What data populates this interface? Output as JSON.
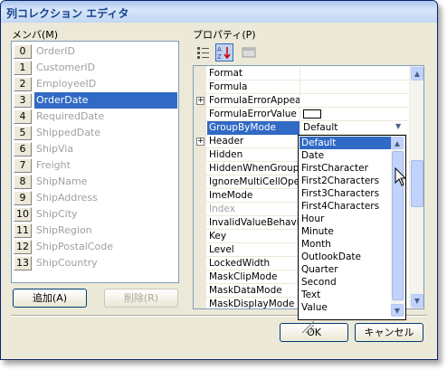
{
  "window": {
    "title": "列コレクション エディタ"
  },
  "members": {
    "label": "メンバ(M)",
    "items": [
      {
        "index": "0",
        "name": "OrderID"
      },
      {
        "index": "1",
        "name": "CustomerID"
      },
      {
        "index": "2",
        "name": "EmployeeID"
      },
      {
        "index": "3",
        "name": "OrderDate"
      },
      {
        "index": "4",
        "name": "RequiredDate"
      },
      {
        "index": "5",
        "name": "ShippedDate"
      },
      {
        "index": "6",
        "name": "ShipVia"
      },
      {
        "index": "7",
        "name": "Freight"
      },
      {
        "index": "8",
        "name": "ShipName"
      },
      {
        "index": "9",
        "name": "ShipAddress"
      },
      {
        "index": "10",
        "name": "ShipCity"
      },
      {
        "index": "11",
        "name": "ShipRegion"
      },
      {
        "index": "12",
        "name": "ShipPostalCode"
      },
      {
        "index": "13",
        "name": "ShipCountry"
      }
    ],
    "selected_index": 3,
    "add_label": "追加(A)",
    "remove_label": "削除(R)"
  },
  "properties": {
    "label": "プロパティ(P)",
    "rows": [
      {
        "name": "Format",
        "value": ""
      },
      {
        "name": "Formula",
        "value": ""
      },
      {
        "name": "FormulaErrorAppear",
        "value": ""
      },
      {
        "name": "FormulaErrorValue",
        "value": ""
      },
      {
        "name": "GroupByMode",
        "value": "Default"
      },
      {
        "name": "Header",
        "value": ""
      },
      {
        "name": "Hidden",
        "value": ""
      },
      {
        "name": "HiddenWhenGroupB",
        "value": ""
      },
      {
        "name": "IgnoreMultiCellOper",
        "value": ""
      },
      {
        "name": "ImeMode",
        "value": ""
      },
      {
        "name": "Index",
        "value": ""
      },
      {
        "name": "InvalidValueBehavio",
        "value": ""
      },
      {
        "name": "Key",
        "value": ""
      },
      {
        "name": "Level",
        "value": ""
      },
      {
        "name": "LockedWidth",
        "value": ""
      },
      {
        "name": "MaskClipMode",
        "value": ""
      },
      {
        "name": "MaskDataMode",
        "value": ""
      },
      {
        "name": "MaskDisplayMode",
        "value": ""
      }
    ],
    "selected_row": "GroupByMode"
  },
  "dropdown": {
    "options": [
      "Default",
      "Date",
      "FirstCharacter",
      "First2Characters",
      "First3Characters",
      "First4Characters",
      "Hour",
      "Minute",
      "Month",
      "OutlookDate",
      "Quarter",
      "Second",
      "Text",
      "Value"
    ],
    "selected": "Default"
  },
  "footer": {
    "ok_label": "OK",
    "cancel_label": "キャンセル"
  }
}
